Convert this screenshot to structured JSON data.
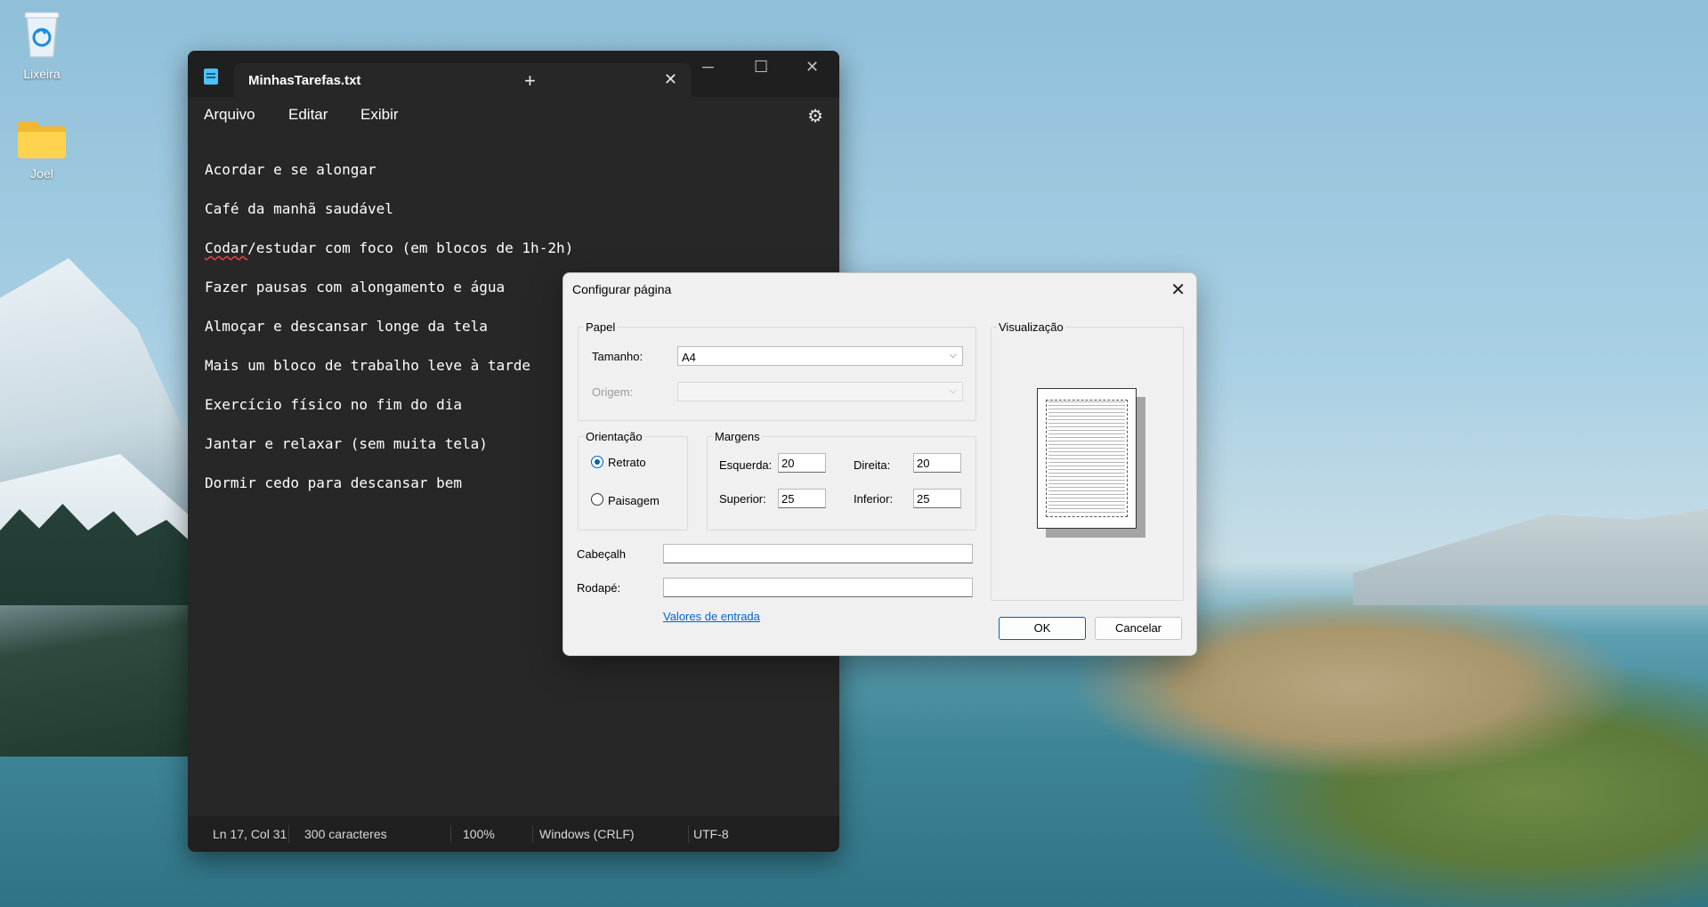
{
  "desktop": {
    "icons": [
      {
        "label": "Lixeira",
        "icon": "recycle-bin-icon"
      },
      {
        "label": "Joel",
        "icon": "folder-icon"
      }
    ]
  },
  "notepad": {
    "tab_title": "MinhasTarefas.txt",
    "menu": {
      "file": "Arquivo",
      "edit": "Editar",
      "view": "Exibir"
    },
    "lines": [
      "Acordar e se alongar",
      "Café da manhã saudável",
      "Codar/estudar com foco (em blocos de 1h-2h)",
      "Fazer pausas com alongamento e água",
      "Almoçar e descansar longe da tela",
      "Mais um bloco de trabalho leve à tarde",
      "Exercício físico no fim do dia",
      "Jantar e relaxar (sem muita tela)",
      "Dormir cedo para descansar bem"
    ],
    "line3_spell_word": "Codar",
    "line3_rest": "/estudar com foco (em blocos de 1h-2h)",
    "status": {
      "position": "Ln 17, Col 31",
      "chars": "300 caracteres",
      "zoom": "100%",
      "line_ending": "Windows (CRLF)",
      "encoding": "UTF-8"
    }
  },
  "dialog": {
    "title": "Configurar página",
    "paper": {
      "group_label": "Papel",
      "size_label": "Tamanho:",
      "size_value": "A4",
      "source_label": "Origem:",
      "source_value": ""
    },
    "orientation": {
      "group_label": "Orientação",
      "portrait": "Retrato",
      "landscape": "Paisagem",
      "selected": "Retrato"
    },
    "margins": {
      "group_label": "Margens",
      "left_label": "Esquerda:",
      "left_value": "20",
      "right_label": "Direita:",
      "right_value": "20",
      "top_label": "Superior:",
      "top_value": "25",
      "bottom_label": "Inferior:",
      "bottom_value": "25"
    },
    "header_label": "Cabeçalh",
    "header_value": "",
    "footer_label": "Rodapé:",
    "footer_value": "",
    "defaults_link": "Valores de entrada",
    "preview_label": "Visualização",
    "ok": "OK",
    "cancel": "Cancelar"
  }
}
